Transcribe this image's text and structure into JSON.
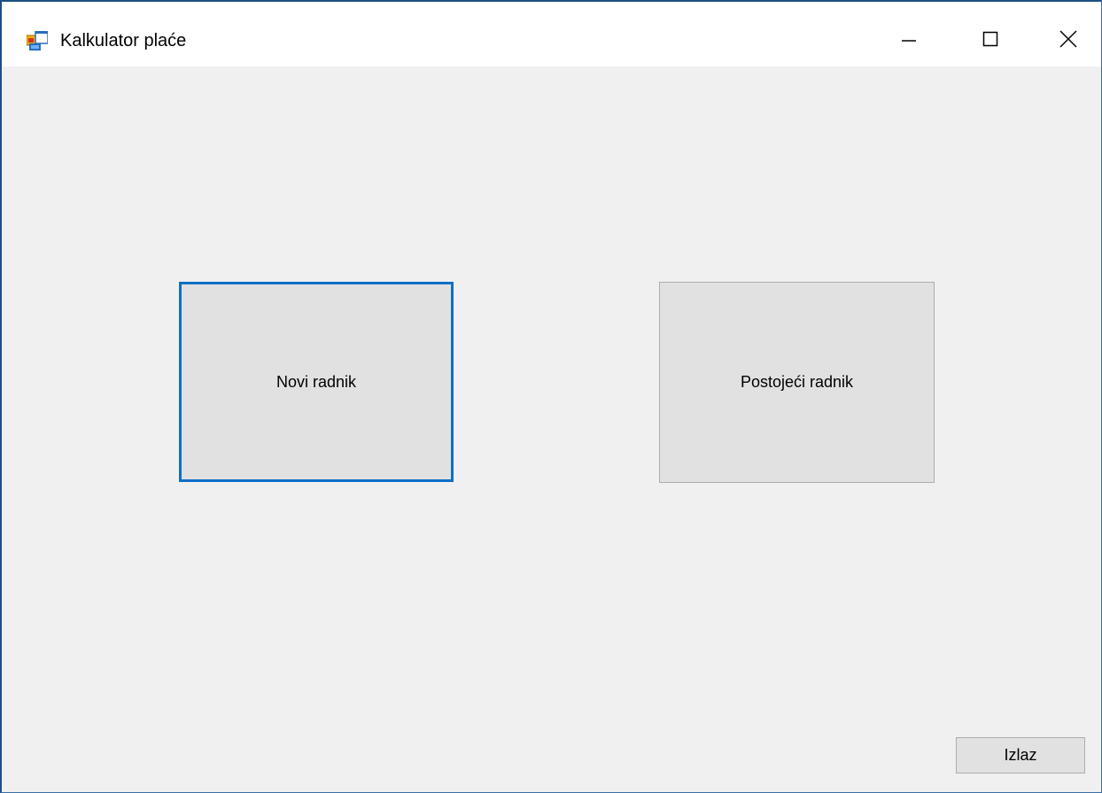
{
  "window": {
    "title": "Kalkulator plaće",
    "icon": "app-form-icon"
  },
  "caption_buttons": {
    "minimize_icon": "minimize-icon",
    "maximize_icon": "maximize-icon",
    "close_icon": "close-icon"
  },
  "main": {
    "new_worker_label": "Novi radnik",
    "existing_worker_label": "Postojeći radnik",
    "exit_label": "Izlaz"
  },
  "colors": {
    "focus_border": "#0e6fc7",
    "button_face": "#e1e1e1",
    "window_background": "#f0f0f0",
    "window_frame": "#1c4f86"
  }
}
